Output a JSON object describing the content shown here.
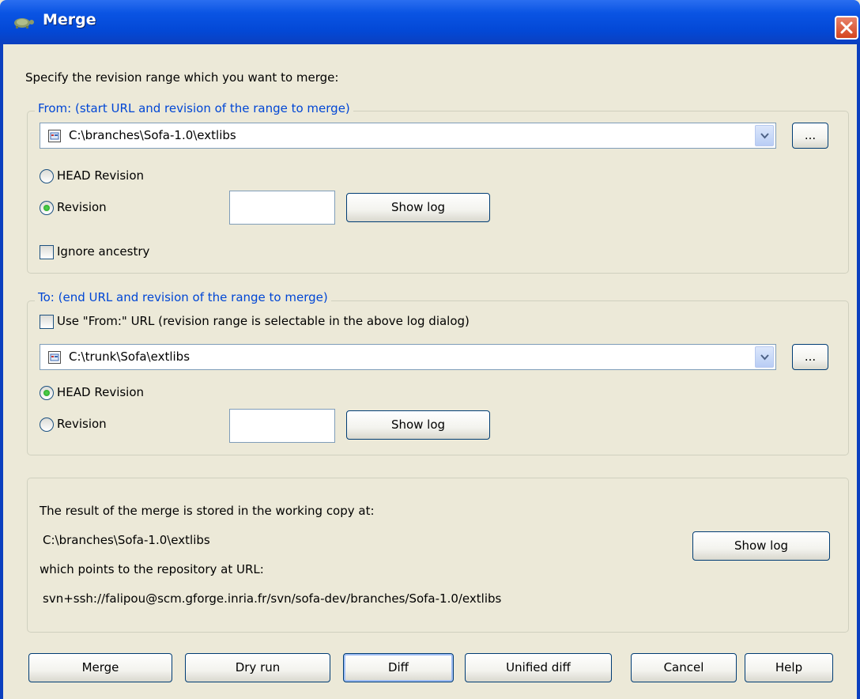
{
  "window": {
    "title": "Merge"
  },
  "intro": "Specify the revision range which you want to merge:",
  "from": {
    "legend": "From: (start URL and revision of the range to merge)",
    "url": "C:\\branches\\Sofa-1.0\\extlibs",
    "browse_label": "...",
    "head_label": "HEAD Revision",
    "revision_label": "Revision",
    "revision_value": "",
    "selected": "revision",
    "show_log_label": "Show log",
    "ignore_ancestry_label": "Ignore ancestry"
  },
  "to": {
    "legend": "To: (end URL and revision of the range to merge)",
    "use_from_label": "Use \"From:\" URL (revision range is selectable in the above log dialog)",
    "url": "C:\\trunk\\Sofa\\extlibs",
    "browse_label": "...",
    "head_label": "HEAD Revision",
    "revision_label": "Revision",
    "revision_value": "",
    "selected": "head",
    "show_log_label": "Show log"
  },
  "result": {
    "stored_text": "The result of the merge is stored in the working copy at:",
    "working_copy": "C:\\branches\\Sofa-1.0\\extlibs",
    "points_text": "which points to the repository at URL:",
    "repo_url": "svn+ssh://falipou@scm.gforge.inria.fr/svn/sofa-dev/branches/Sofa-1.0/extlibs",
    "show_log_label": "Show log"
  },
  "buttons": {
    "merge": "Merge",
    "dry_run": "Dry run",
    "diff": "Diff",
    "unified_diff": "Unified diff",
    "cancel": "Cancel",
    "help": "Help"
  },
  "colors": {
    "title_bar": "#0a54e3",
    "group_legend": "#0046d5",
    "dialog_bg": "#ece9d8",
    "close_button": "#d5441e"
  }
}
